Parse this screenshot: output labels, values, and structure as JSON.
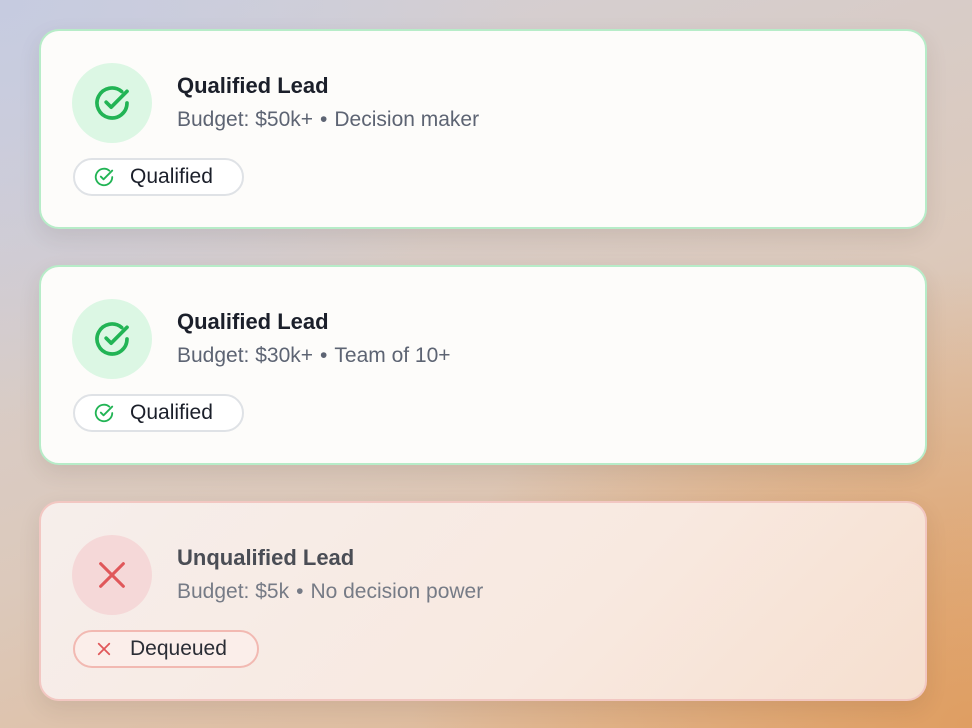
{
  "leads": [
    {
      "status": "qualified",
      "title": "Qualified Lead",
      "budget": "Budget: $50k+",
      "separator": "•",
      "detail": "Decision maker",
      "badge_label": "Qualified",
      "icon": "check-circle-icon"
    },
    {
      "status": "qualified",
      "title": "Qualified Lead",
      "budget": "Budget: $30k+",
      "separator": "•",
      "detail": "Team of 10+",
      "badge_label": "Qualified",
      "icon": "check-circle-icon"
    },
    {
      "status": "unqualified",
      "title": "Unqualified Lead",
      "budget": "Budget: $5k",
      "separator": "•",
      "detail": "No decision power",
      "badge_label": "Dequeued",
      "icon": "x-icon"
    }
  ],
  "colors": {
    "success": "#22b455",
    "danger": "#e0575a",
    "success_border": "#b7ecc8",
    "danger_border": "#f2c7c2"
  }
}
